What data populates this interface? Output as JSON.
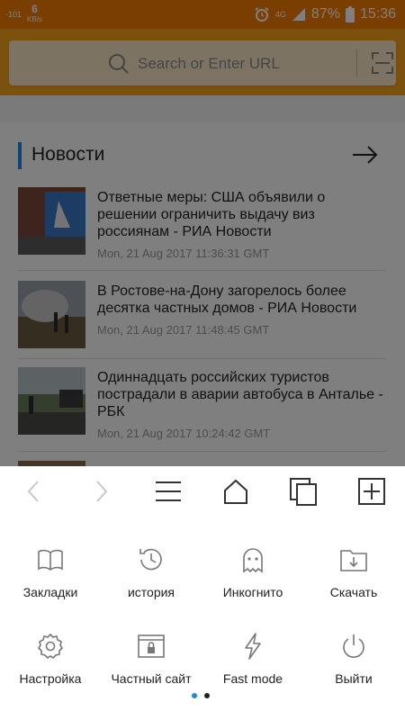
{
  "status_bar": {
    "signal_left": "·101",
    "speed_value": "6",
    "speed_unit": "KB/s",
    "network": "4G",
    "battery": "87%",
    "time": "15:36"
  },
  "search": {
    "placeholder": "Search or Enter URL"
  },
  "news": {
    "title": "Новости",
    "items": [
      {
        "title": "Ответные меры: США объявили о решении ограничить выдачу виз россиянам - РИА Новости",
        "date": "Mon, 21 Aug 2017 11:36:31 GMT"
      },
      {
        "title": "В Ростове-на-Дону загорелось более десятка частных домов - РИА Новости",
        "date": "Mon, 21 Aug 2017 11:48:45 GMT"
      },
      {
        "title": "Одиннадцать российских туристов пострадали в аварии автобуса в Анталье - РБК",
        "date": "Mon, 21 Aug 2017 10:24:42 GMT"
      }
    ]
  },
  "menu": {
    "row1": [
      {
        "label": "Закладки",
        "icon": "bookmarks-icon"
      },
      {
        "label": "история",
        "icon": "history-icon"
      },
      {
        "label": "Инкогнито",
        "icon": "ghost-icon"
      },
      {
        "label": "Скачать",
        "icon": "download-folder-icon"
      }
    ],
    "row2": [
      {
        "label": "Настройка",
        "icon": "gear-icon"
      },
      {
        "label": "Частный сайт",
        "icon": "private-site-icon"
      },
      {
        "label": "Fast mode",
        "icon": "lightning-icon"
      },
      {
        "label": "Выйти",
        "icon": "power-icon"
      }
    ],
    "page_indicator": {
      "pages": 2,
      "active": 1
    }
  },
  "colors": {
    "status_bar": "#f57c00",
    "header": "#f7a21a",
    "accent_blue": "#1e88e5"
  }
}
